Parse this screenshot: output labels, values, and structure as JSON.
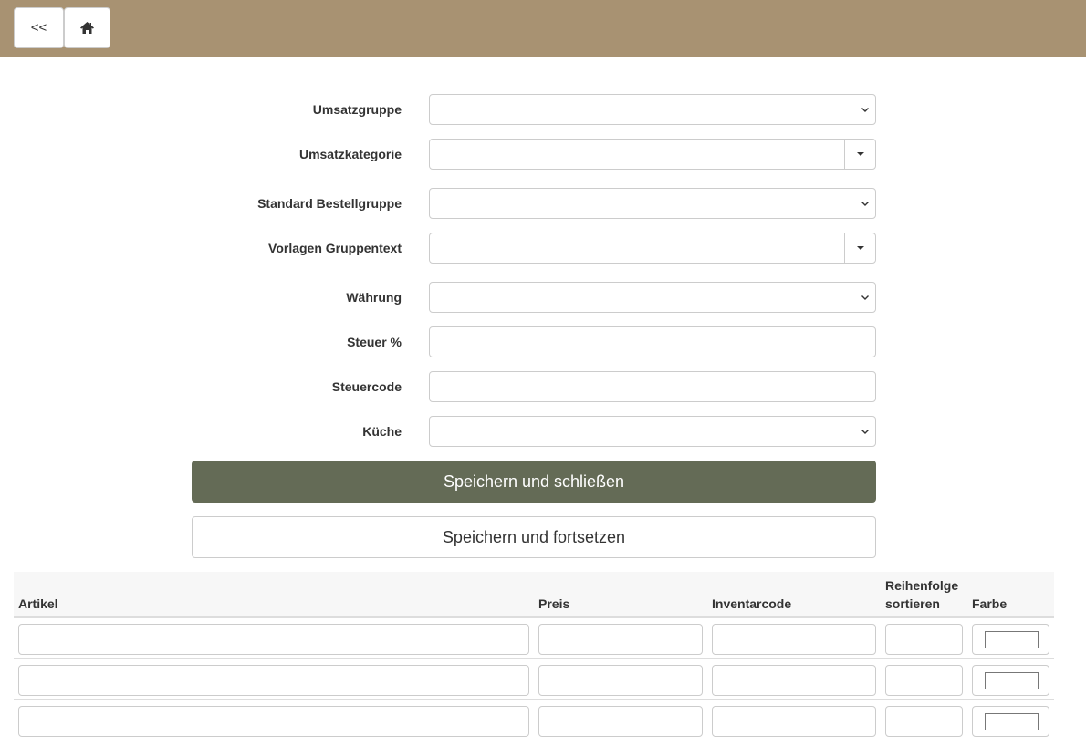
{
  "nav": {
    "back_label": "<<",
    "home_icon": "home-icon"
  },
  "form": {
    "fields": [
      {
        "label": "Umsatzgruppe",
        "type": "select",
        "value": ""
      },
      {
        "label": "Umsatzkategorie",
        "type": "combo",
        "value": ""
      },
      {
        "label": "Standard Bestellgruppe",
        "type": "select",
        "value": ""
      },
      {
        "label": "Vorlagen Gruppentext",
        "type": "combo",
        "value": ""
      },
      {
        "label": "Währung",
        "type": "select",
        "value": ""
      },
      {
        "label": "Steuer %",
        "type": "text",
        "value": ""
      },
      {
        "label": "Steuercode",
        "type": "text",
        "value": ""
      },
      {
        "label": "Küche",
        "type": "select",
        "value": ""
      }
    ],
    "save_close_label": "Speichern und schließen",
    "save_continue_label": "Speichern und fortsetzen"
  },
  "table": {
    "headers": {
      "artikel": "Artikel",
      "preis": "Preis",
      "inventarcode": "Inventarcode",
      "reihenfolge_line1": "Reihenfolge",
      "reihenfolge_line2": "sortieren",
      "farbe": "Farbe"
    },
    "rows": [
      {
        "artikel": "",
        "preis": "",
        "inventarcode": "",
        "sort": "",
        "farbe": "#ffffff"
      },
      {
        "artikel": "",
        "preis": "",
        "inventarcode": "",
        "sort": "",
        "farbe": "#ffffff"
      },
      {
        "artikel": "",
        "preis": "",
        "inventarcode": "",
        "sort": "",
        "farbe": "#ffffff"
      }
    ]
  },
  "colors": {
    "header_bar": "#a89272",
    "primary_button": "#646b56"
  }
}
